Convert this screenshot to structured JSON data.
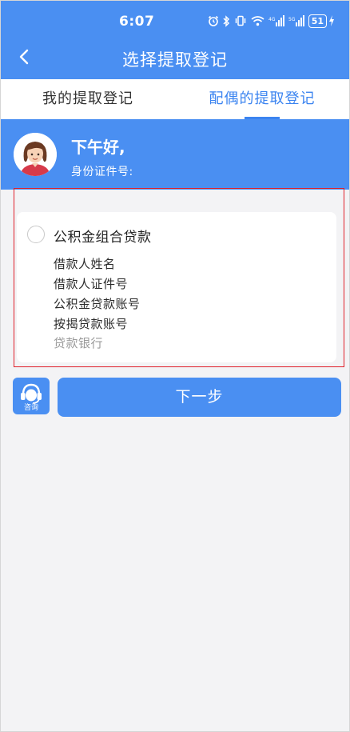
{
  "status_bar": {
    "time": "6:07",
    "battery": "51",
    "icons": [
      "alarm-icon",
      "bluetooth-icon",
      "vibrate-icon",
      "wifi-icon",
      "signal-4g-icon",
      "signal-5g-icon",
      "charging-icon"
    ]
  },
  "header": {
    "title": "选择提取登记",
    "back_icon": "chevron-left-icon"
  },
  "tabs": [
    {
      "label": "我的提取登记",
      "active": false
    },
    {
      "label": "配偶的提取登记",
      "active": true
    }
  ],
  "greeting": {
    "title": "下午好,",
    "id_label": "身份证件号:"
  },
  "loan_card": {
    "title": "公积金组合贷款",
    "selected": false,
    "fields": [
      "借款人姓名",
      "借款人证件号",
      "公积金贷款账号",
      "按揭贷款账号",
      "贷款银行"
    ]
  },
  "actions": {
    "consult_label": "咨询",
    "next_label": "下一步"
  },
  "colors": {
    "primary": "#4a8ff2",
    "tab_active": "#3b84f0",
    "highlight": "#e0202a",
    "background": "#f3f3f5"
  }
}
